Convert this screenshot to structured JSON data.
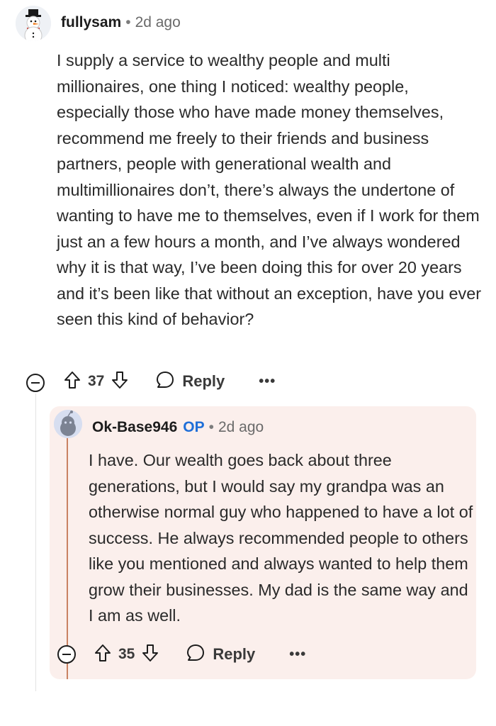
{
  "comment": {
    "username": "fullysam",
    "separator": "•",
    "age": "2d ago",
    "body": "I supply a service to wealthy people and multi millionaires, one thing I noticed: wealthy people, especially those who have made money themselves, recommend me freely to their friends and business partners, people with generational wealth and multimillionaires don’t, there’s always the undertone of wanting to have me to themselves, even if I work for them just an a few hours a month, and I’ve always wondered why it is that way, I’ve been doing this for over 20 years and it’s been like that without an exception, have you ever seen this kind of behavior?",
    "votes": "37",
    "reply_label": "Reply",
    "more_label": "•••"
  },
  "reply": {
    "username": "Ok-Base946",
    "op_badge": "OP",
    "separator": "•",
    "age": "2d ago",
    "body": "I have. Our wealth goes back about three generations, but I would say my grandpa was an otherwise normal guy who happened to have a lot of success. He always recommended people to others like you mentioned and always wanted to help them grow their businesses. My dad is the same way and I am as well.",
    "votes": "35",
    "reply_label": "Reply",
    "more_label": "•••"
  },
  "colors": {
    "reply_card_bg": "#fbefec",
    "thread_line_accent": "#c98262",
    "op_badge": "#1f6fd8"
  },
  "icons": [
    "snowman-avatar-icon",
    "snoo-avatar-icon",
    "upvote-icon",
    "downvote-icon",
    "reply-bubble-icon",
    "collapse-icon"
  ]
}
